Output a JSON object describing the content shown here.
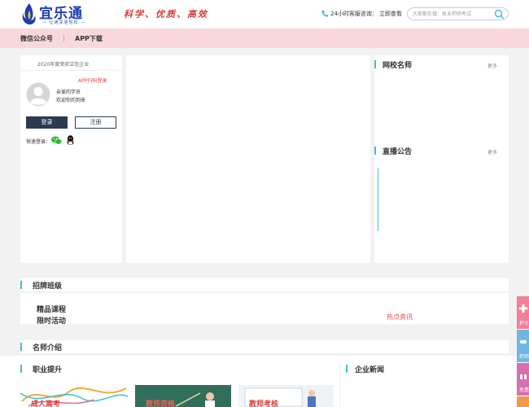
{
  "header": {
    "logo_name": "宜乐通",
    "logo_tagline": "— 让通关更轻松 —",
    "slogan": "科学、优质、高效",
    "hotline_label": "24小时客服咨询：",
    "hotline_link": "立即查看",
    "search_placeholder": "大家都在搜：执业药师考试"
  },
  "nav": {
    "items": [
      {
        "label": "微信公众号"
      },
      {
        "label": "APP下载"
      }
    ]
  },
  "login": {
    "badge": "2020年度荣获立信企业",
    "scan_login": "APP扫码登录",
    "greeting_1": "亲爱的学员",
    "greeting_2": "欢迎你的到来",
    "login_label": "登录",
    "register_label": "注册",
    "quick_login_label": "快速登录："
  },
  "side": {
    "teachers_title": "网校名师",
    "teachers_more": "更多",
    "notice_title": "直播公告",
    "notice_more": "更多"
  },
  "recruit": {
    "title": "招牌班级",
    "categories": [
      "精品课程",
      "限时活动"
    ],
    "hot_news": "热点资讯"
  },
  "teachers_intro": {
    "title": "名师介绍"
  },
  "career": {
    "title": "职业提升",
    "news_title": "企业新闻",
    "thumbs": [
      {
        "caption": "成人高考"
      },
      {
        "caption": "教师资格"
      },
      {
        "caption": "教师考核"
      }
    ]
  },
  "float_bar": {
    "items": [
      {
        "label": "护士"
      },
      {
        "label": "药师"
      },
      {
        "label": "免费"
      },
      {
        "label": ""
      }
    ]
  },
  "colors": {
    "brand_blue": "#1f3fb0",
    "slogan_red": "#d93a3a",
    "nav_pink": "#f9d8dc",
    "accent_teal": "#3cbfcf",
    "button_navy": "#2b3a50",
    "hot_red": "#e04b4b"
  }
}
